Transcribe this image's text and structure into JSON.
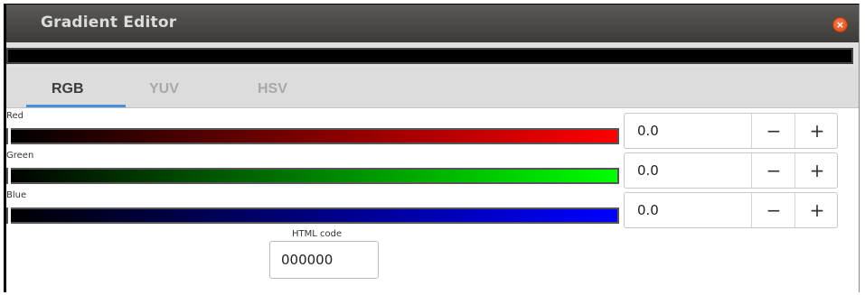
{
  "window": {
    "title": "Gradient Editor",
    "close_icon": "close-icon"
  },
  "tabs": [
    {
      "label": "RGB",
      "active": true
    },
    {
      "label": "YUV",
      "active": false
    },
    {
      "label": "HSV",
      "active": false
    }
  ],
  "channels": [
    {
      "label": "Red",
      "value": "0.0",
      "color_end": "#ff0000"
    },
    {
      "label": "Green",
      "value": "0.0",
      "color_end": "#00ff00"
    },
    {
      "label": "Blue",
      "value": "0.0",
      "color_end": "#0000ff"
    }
  ],
  "spin": {
    "minus": "−",
    "plus": "+"
  },
  "html_code": {
    "label": "HTML code",
    "value": "000000"
  },
  "colors": {
    "accent": "#4a90d9",
    "titlebar": "#3c3b37",
    "close": "#df4a16"
  }
}
